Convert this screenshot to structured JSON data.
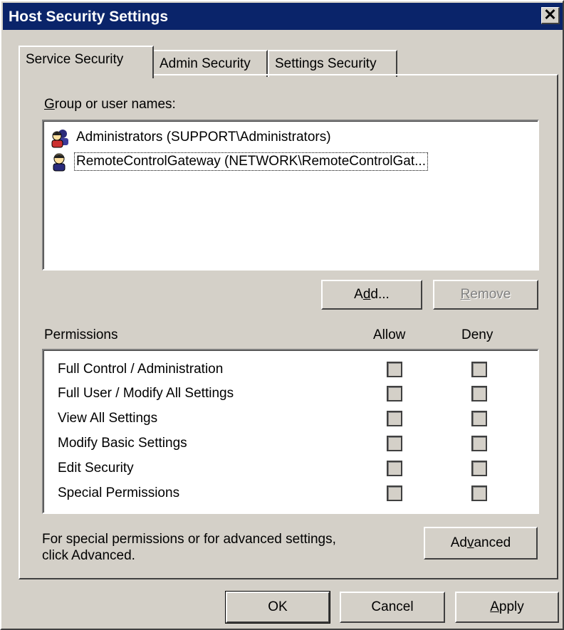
{
  "window": {
    "title": "Host Security Settings",
    "close_glyph": "✕"
  },
  "tabs": [
    {
      "label": "Service Security",
      "active": true
    },
    {
      "label": "Admin Security",
      "active": false
    },
    {
      "label": "Settings Security",
      "active": false
    }
  ],
  "groups": {
    "label_prefix_mnemonic": "G",
    "label_rest": "roup or user names:",
    "items": [
      {
        "name": "Administrators (SUPPORT\\Administrators)",
        "icon": "user-group-icon",
        "focused": false
      },
      {
        "name": "RemoteControlGateway (NETWORK\\RemoteControlGat...",
        "icon": "user-icon",
        "focused": true
      }
    ],
    "add_button": {
      "pre": "A",
      "mnemonic": "d",
      "post": "d..."
    },
    "remove_button": {
      "pre": "",
      "mnemonic": "R",
      "post": "emove",
      "disabled": true
    }
  },
  "permissions": {
    "header": "Permissions",
    "allow_header": "Allow",
    "deny_header": "Deny",
    "rows": [
      {
        "name": "Full Control / Administration",
        "allow": false,
        "deny": false
      },
      {
        "name": "Full User / Modify All Settings",
        "allow": false,
        "deny": false
      },
      {
        "name": "View All Settings",
        "allow": false,
        "deny": false
      },
      {
        "name": "Modify Basic Settings",
        "allow": false,
        "deny": false
      },
      {
        "name": "Edit Security",
        "allow": false,
        "deny": false
      },
      {
        "name": "Special Permissions",
        "allow": false,
        "deny": false
      }
    ]
  },
  "advanced": {
    "hint_line1": "For special permissions or for advanced settings,",
    "hint_line2": "click Advanced.",
    "button": {
      "pre": "Ad",
      "mnemonic": "v",
      "post": "anced"
    }
  },
  "footer": {
    "ok": "OK",
    "cancel": "Cancel",
    "apply": {
      "pre": "",
      "mnemonic": "A",
      "post": "pply"
    }
  },
  "colors": {
    "titlebar": "#0a246a",
    "face": "#d4d0c8",
    "shadow": "#808080",
    "dark": "#404040"
  }
}
